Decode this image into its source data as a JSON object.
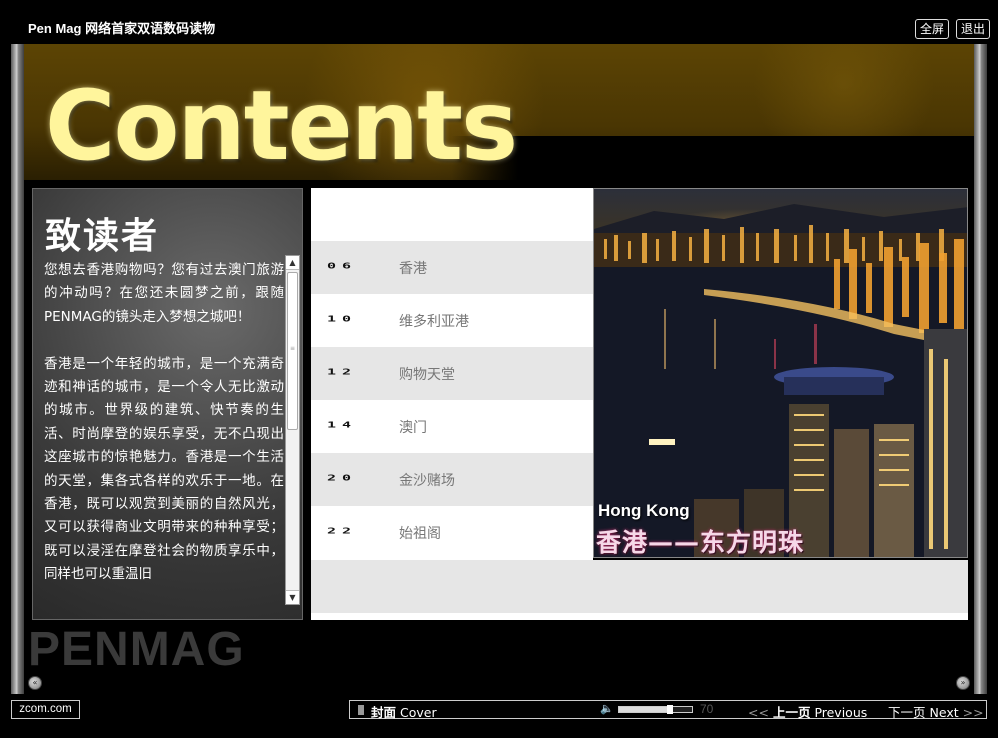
{
  "app": {
    "title": "Pen Mag 网络首家双语数码读物",
    "fullscreen_label": "全屏",
    "exit_label": "退出"
  },
  "banner": {
    "title": "Contents"
  },
  "intro": {
    "heading": "致读者",
    "paragraphs": [
      "您想去香港购物吗？您有过去澳门旅游的冲动吗？在您还未圆梦之前，跟随PENMAG的镜头走入梦想之城吧！",
      "香港是一个年轻的城市，是一个充满奇迹和神话的城市，是一个令人无比激动的城市。世界级的建筑、快节奏的生活、时尚摩登的娱乐享受，无不凸现出这座城市的惊艳魅力。香港是一个生活的天堂，集各式各样的欢乐于一地。在香港，既可以观赏到美丽的自然风光，又可以获得商业文明带来的种种享受；既可以浸淫在摩登社会的物质享乐中，同样也可以重温旧"
    ]
  },
  "toc": {
    "items": [
      {
        "page": "06",
        "title": "香港"
      },
      {
        "page": "10",
        "title": "维多利亚港"
      },
      {
        "page": "12",
        "title": "购物天堂"
      },
      {
        "page": "14",
        "title": "澳门"
      },
      {
        "page": "20",
        "title": "金沙赌场"
      },
      {
        "page": "22",
        "title": "始祖阁"
      }
    ]
  },
  "photo": {
    "caption_en": "Hong Kong",
    "caption_cn": "香港——东方明珠"
  },
  "watermark": "PENMAG",
  "footer": {
    "site": "zcom.com",
    "cover_cn": "封面",
    "cover_en": "Cover",
    "volume": 70,
    "volume_arrows_prev": "<<",
    "prev_cn": "上一页",
    "prev_en": "Previous",
    "next_cn": "下一页",
    "next_en": "Next",
    "volume_arrows_next": ">>"
  },
  "colors": {
    "banner_gold": "#5c4404",
    "title_yellow": "#fff59c",
    "row_shade": "#e6e6e6",
    "toc_text": "#777777"
  }
}
